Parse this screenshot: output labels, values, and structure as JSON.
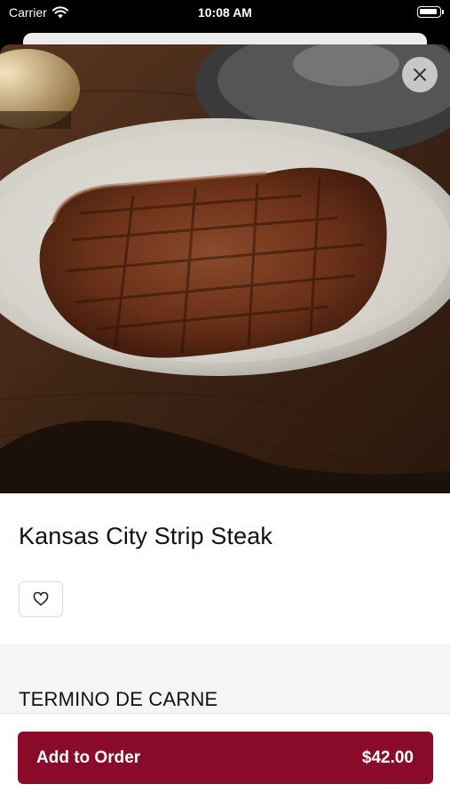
{
  "status_bar": {
    "carrier": "Carrier",
    "time": "10:08 AM"
  },
  "item": {
    "title": "Kansas City Strip Steak"
  },
  "options": {
    "section_title": "TERMINO DE CARNE"
  },
  "order_button": {
    "label": "Add to Order",
    "price": "$42.00"
  },
  "colors": {
    "accent": "#8a0a2a",
    "options_bg": "#f5f5f5"
  },
  "icons": {
    "close": "close-icon",
    "favorite": "heart-icon",
    "wifi": "wifi-icon",
    "battery": "battery-icon"
  }
}
